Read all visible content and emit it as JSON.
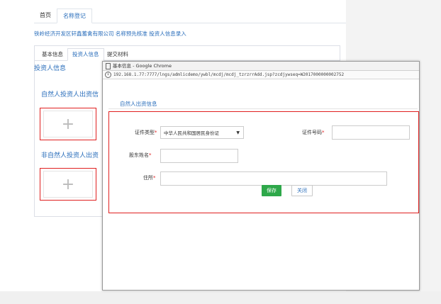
{
  "top_tabs": [
    {
      "label": "首页",
      "active": false
    },
    {
      "label": "名称登记",
      "active": true
    }
  ],
  "company_line": "铁岭经济开发区轩鑫蓄禽有限公司 名称预先核准 投资人信息录入",
  "sub_tabs": [
    {
      "label": "基本信息",
      "active": false
    },
    {
      "label": "投资人信息",
      "active": true
    },
    {
      "label": "提交材料",
      "active": false
    }
  ],
  "section_title": "投资人信息",
  "natural_investor_label": "自然人投资人出资信",
  "non_natural_investor_label": "非自然人投资人出资",
  "add_icon": "plus-icon",
  "popup": {
    "window_title": "基本信息 - Google Chrome",
    "url": "192.168.1.77:7777/lngs/admlicdemo/ywbl/mcdj/mcdj_tzrzrrAdd.jsp?zcdjywseq=W2017000000002752",
    "section_title": "自然人出资信息",
    "fields": {
      "id_type_label": "证件类型",
      "id_type_value": "中华人民共和国居民身份证",
      "id_number_label": "证件号码",
      "shareholder_name_label": "股东姓名",
      "address_label": "住所"
    },
    "required_mark": "*",
    "save_label": "保存",
    "close_label": "关闭"
  },
  "colors": {
    "accent": "#2a6ebb",
    "highlight": "#e02020",
    "save": "#2ea84a"
  }
}
